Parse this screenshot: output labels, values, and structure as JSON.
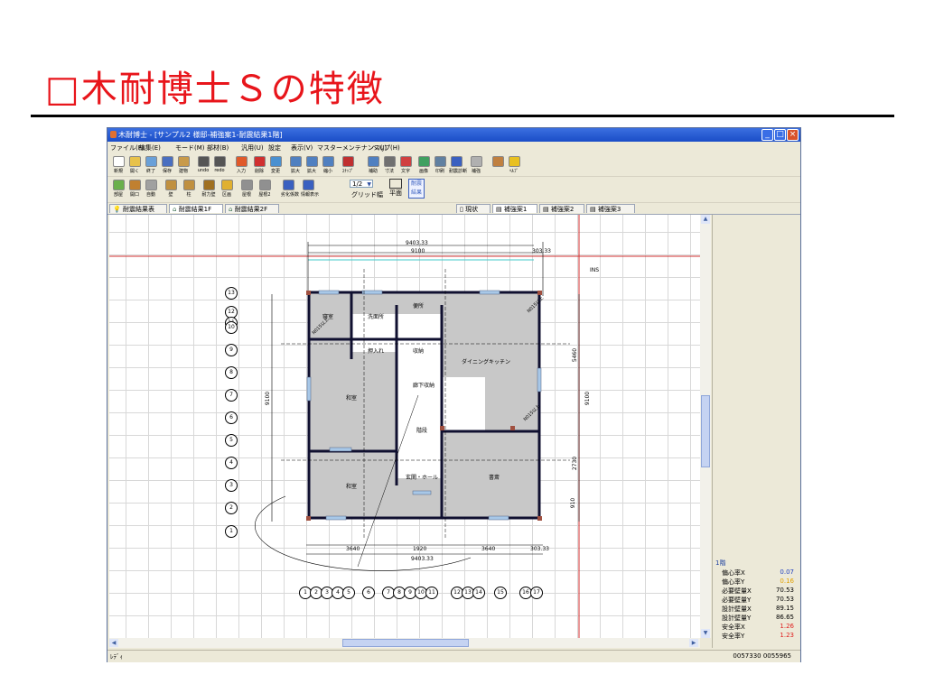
{
  "slide": {
    "title": "□木耐博士Ｓの特徴"
  },
  "window": {
    "title": "木耐博士 - [サンプル2  様邸-補強案1-耐震結果1階]"
  },
  "menu": [
    "ファイル(F)",
    "編集(E)",
    "モード(M)",
    "部材(B)",
    "汎用(U)",
    "設定",
    "表示(V)",
    "マスターメンテナンス(J)",
    "ヘルプ(H)"
  ],
  "toolbar1": [
    {
      "label": "新規",
      "icon": "new-icon",
      "color": "#ffffff"
    },
    {
      "label": "開く",
      "icon": "open-icon",
      "color": "#e8c24a"
    },
    {
      "label": "終了",
      "icon": "exit-icon",
      "color": "#6aa0d8"
    },
    {
      "label": "保存",
      "icon": "save-icon",
      "color": "#4a6fc0"
    },
    {
      "label": "建物",
      "icon": "building-icon",
      "color": "#c89a4a"
    },
    {
      "label": "undo",
      "icon": "undo-icon",
      "color": "#555555"
    },
    {
      "label": "redo",
      "icon": "redo-icon",
      "color": "#555555"
    },
    {
      "label": "入力",
      "icon": "input-icon",
      "color": "#e05a2a"
    },
    {
      "label": "削除",
      "icon": "delete-icon",
      "color": "#d03030"
    },
    {
      "label": "変更",
      "icon": "change-icon",
      "color": "#4a90d0"
    },
    {
      "label": "拡大",
      "icon": "zoom-in-icon",
      "color": "#5080c0"
    },
    {
      "label": "拡大",
      "icon": "zoom-area-icon",
      "color": "#5080c0"
    },
    {
      "label": "縮小",
      "icon": "zoom-out-icon",
      "color": "#5080c0"
    },
    {
      "label": "ｽﾅｯﾌﾟ",
      "icon": "snap-icon",
      "color": "#c03030"
    },
    {
      "label": "補助",
      "icon": "aux-icon",
      "color": "#5080c0"
    },
    {
      "label": "寸法",
      "icon": "dimension-icon",
      "color": "#707070"
    },
    {
      "label": "文字",
      "icon": "text-icon",
      "color": "#d04040"
    },
    {
      "label": "画像",
      "icon": "image-icon",
      "color": "#40a060"
    },
    {
      "label": "印刷",
      "icon": "print-icon",
      "color": "#6080a0"
    },
    {
      "label": "耐震診断",
      "icon": "diagnosis-icon",
      "color": "#3a60c0"
    },
    {
      "label": "補強",
      "icon": "reinforce-icon",
      "color": "#b0b0b0"
    },
    {
      "label": "",
      "icon": "person-icon",
      "color": "#c08040"
    },
    {
      "label": "ﾍﾙﾌﾟ",
      "icon": "help-icon",
      "color": "#e8c020"
    }
  ],
  "toolbar2": [
    {
      "label": "部屋",
      "icon": "room-icon",
      "color": "#6ab04c"
    },
    {
      "label": "開口",
      "icon": "opening-icon",
      "color": "#c08030"
    },
    {
      "label": "自動",
      "icon": "auto-icon",
      "color": "#a0a0a0"
    },
    {
      "label": "壁",
      "icon": "wall-icon",
      "color": "#c09040"
    },
    {
      "label": "柱",
      "icon": "column-icon",
      "color": "#c09040"
    },
    {
      "label": "耐力壁",
      "icon": "bearing-wall-icon",
      "color": "#a07020"
    },
    {
      "label": "区画",
      "icon": "section-icon",
      "color": "#e0b030"
    },
    {
      "label": "屋根",
      "icon": "roof-icon",
      "color": "#909090"
    },
    {
      "label": "屋根2",
      "icon": "roof2-icon",
      "color": "#909090"
    },
    {
      "label": "劣化係数",
      "icon": "deterioration-icon",
      "color": "#3a60c0"
    },
    {
      "label": "情報表示",
      "icon": "info-icon",
      "color": "#3a60c0"
    }
  ],
  "grid_select": {
    "value": "1/2",
    "label": "グリッド幅"
  },
  "plane_label": "平面",
  "result_label": "耐震結果",
  "left_tabs": [
    "耐震結果表",
    "耐震結果1F",
    "耐震結果2F"
  ],
  "right_tabs": [
    "現状",
    "補強案1",
    "補強案2",
    "補強案3"
  ],
  "plan": {
    "dims": {
      "total": "9403.33",
      "inner": "9100",
      "right": "303.33",
      "bottom": [
        "3640",
        "1920",
        "3640",
        "303.33"
      ],
      "bottom_total": "9403.33",
      "left": "9100",
      "right_side": [
        "5460",
        "9100",
        "2730",
        "910"
      ]
    },
    "rooms": [
      "便所",
      "寝室",
      "洗面所",
      "押入れ",
      "収納",
      "ダイニングキッチン",
      "和室",
      "廊下収納",
      "階段",
      "玄関・ホール",
      "和室",
      "書斎"
    ],
    "row_markers": [
      "13",
      "12",
      "11",
      "10",
      "9",
      "8",
      "7",
      "6",
      "5",
      "4",
      "3",
      "2",
      "1"
    ],
    "col_markers": [
      "1",
      "2",
      "3",
      "4",
      "5",
      "6",
      "7",
      "8",
      "9",
      "10",
      "11",
      "12",
      "13",
      "14",
      "15",
      "16",
      "17"
    ],
    "tags": [
      "N015以上"
    ],
    "ins": "INS"
  },
  "results": {
    "floor": "1階",
    "rows": [
      {
        "key": "偏心率X",
        "value": "0.07",
        "color": "#2040c0"
      },
      {
        "key": "偏心率Y",
        "value": "0.16",
        "color": "#e0a000"
      },
      {
        "key": "必要壁量X",
        "value": "70.53",
        "color": "#000000"
      },
      {
        "key": "必要壁量Y",
        "value": "70.53",
        "color": "#000000"
      },
      {
        "key": "設計壁量X",
        "value": "89.15",
        "color": "#000000"
      },
      {
        "key": "設計壁量Y",
        "value": "86.65",
        "color": "#000000"
      },
      {
        "key": "安全率X",
        "value": "1.26",
        "color": "#e02020"
      },
      {
        "key": "安全率Y",
        "value": "1.23",
        "color": "#e02020"
      }
    ]
  },
  "status": {
    "left": "ﾚﾃﾞｨ",
    "right": "0057330  0055965"
  }
}
